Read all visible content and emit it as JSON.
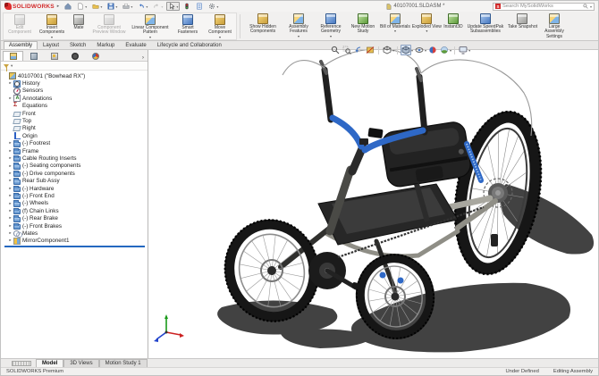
{
  "titlebar": {
    "app_name": "SOLIDWORKS",
    "document_title": "40107001.SLDASM *",
    "search_placeholder": "Search MySolidWorks"
  },
  "command_manager": {
    "active_tab": "Assembly",
    "tabs": [
      "Assembly",
      "Layout",
      "Sketch",
      "Markup",
      "Evaluate",
      "Lifecycle and Collaboration"
    ],
    "buttons": [
      {
        "label": "Edit Component",
        "disabled": true
      },
      {
        "label": "Insert Components",
        "dropdown": true
      },
      {
        "label": "Mate"
      },
      {
        "label": "Component Preview Window",
        "disabled": true
      },
      {
        "label": "Linear Component Pattern",
        "dropdown": true
      },
      {
        "label": "Smart Fasteners"
      },
      {
        "label": "Move Component",
        "dropdown": true
      },
      {
        "label": "Show Hidden Components"
      },
      {
        "label": "Assembly Features",
        "dropdown": true
      },
      {
        "label": "Reference Geometry",
        "dropdown": true
      },
      {
        "label": "New Motion Study"
      },
      {
        "label": "Bill of Materials",
        "dropdown": true
      },
      {
        "label": "Exploded View",
        "dropdown": true
      },
      {
        "label": "Instant3D"
      },
      {
        "label": "Update SpeedPak Subassemblies"
      },
      {
        "label": "Take Snapshot"
      },
      {
        "label": "Large Assembly Settings"
      }
    ]
  },
  "feature_tree": {
    "root_label": "40107001 (\"Bowhead RX\")",
    "items": [
      {
        "label": "History",
        "icon": "history-folder-icon"
      },
      {
        "label": "Sensors",
        "icon": "sensors-icon"
      },
      {
        "label": "Annotations",
        "icon": "annotations-icon"
      },
      {
        "label": "Equations",
        "icon": "equations-icon"
      },
      {
        "label": "Front",
        "icon": "plane-icon"
      },
      {
        "label": "Top",
        "icon": "plane-icon"
      },
      {
        "label": "Right",
        "icon": "plane-icon"
      },
      {
        "label": "Origin",
        "icon": "origin-icon"
      },
      {
        "label": "(-) Footrest",
        "icon": "folder-icon"
      },
      {
        "label": "Frame",
        "icon": "folder-icon"
      },
      {
        "label": "Cable Routing Inserts",
        "icon": "folder-icon"
      },
      {
        "label": "(-) Seating components",
        "icon": "folder-icon"
      },
      {
        "label": "(-) Drive components",
        "icon": "folder-icon"
      },
      {
        "label": "Rear Sub Assy",
        "icon": "folder-icon"
      },
      {
        "label": "(-) Hardware",
        "icon": "folder-icon"
      },
      {
        "label": "(-) Front End",
        "icon": "folder-icon"
      },
      {
        "label": "(-) Wheels",
        "icon": "folder-icon"
      },
      {
        "label": "(f) Chain Links",
        "icon": "folder-icon"
      },
      {
        "label": "(-) Rear Brake",
        "icon": "folder-icon"
      },
      {
        "label": "(-) Front Brakes",
        "icon": "folder-icon"
      },
      {
        "label": "Mates",
        "icon": "mates-icon"
      },
      {
        "label": "MirrorComponent1",
        "icon": "mirror-icon"
      }
    ]
  },
  "bottom_tabs": {
    "active_tab": "Model",
    "tabs": [
      "Model",
      "3D Views",
      "Motion Study 1"
    ]
  },
  "status_bar": {
    "product": "SOLIDWORKS Premium",
    "constraint_state": "Under Defined",
    "mode": "Editing Assembly"
  },
  "glyphs": {
    "dropdown": "▾",
    "expand": "▸",
    "menu_expand": "▸",
    "panel_overflow": "›"
  },
  "accent_colors": {
    "solidworks_red": "#d22a2a",
    "rollback_bar_blue": "#2468c0",
    "model_accent_blue": "#2e68c6"
  }
}
